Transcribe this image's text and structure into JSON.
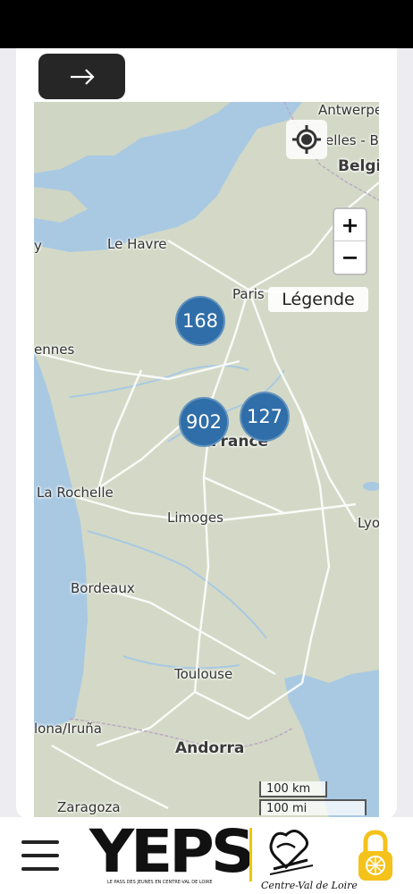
{
  "header": {
    "back_icon": "arrow-right-icon"
  },
  "map": {
    "labels": {
      "antwerpen": "Antwerpe",
      "bruxelles": "elles - Bru",
      "belgique": "Belgi",
      "le_havre": "Le Havre",
      "paris": "Paris",
      "rennes": "ennes",
      "france": "France",
      "la_rochelle": "La Rochelle",
      "limoges": "Limoges",
      "lyon": "Lyo",
      "bordeaux": "Bordeaux",
      "toulouse": "Toulouse",
      "pamplona": "lona/Iruña",
      "andorra": "Andorra",
      "zaragoza": "Zaragoza",
      "y_fragment": "y"
    },
    "clusters": [
      {
        "id": "cluster-168",
        "count": "168"
      },
      {
        "id": "cluster-902",
        "count": "902"
      },
      {
        "id": "cluster-127",
        "count": "127"
      }
    ],
    "zoom_in": "+",
    "zoom_out": "−",
    "legend": "Légende",
    "scale_km": "100 km",
    "scale_mi": "100 mi",
    "colors": {
      "sea": "#a9c9e3",
      "land": "#d3d9c6",
      "cluster": "#2f6ea8"
    }
  },
  "footer": {
    "yeps_logo": "YEPS",
    "yeps_tagline": "LE PASS DES JEUNES EN CENTRE-VAL DE LOIRE",
    "region_logo": "Centre-Val de Loire",
    "lock_icon": "lock-icon"
  }
}
